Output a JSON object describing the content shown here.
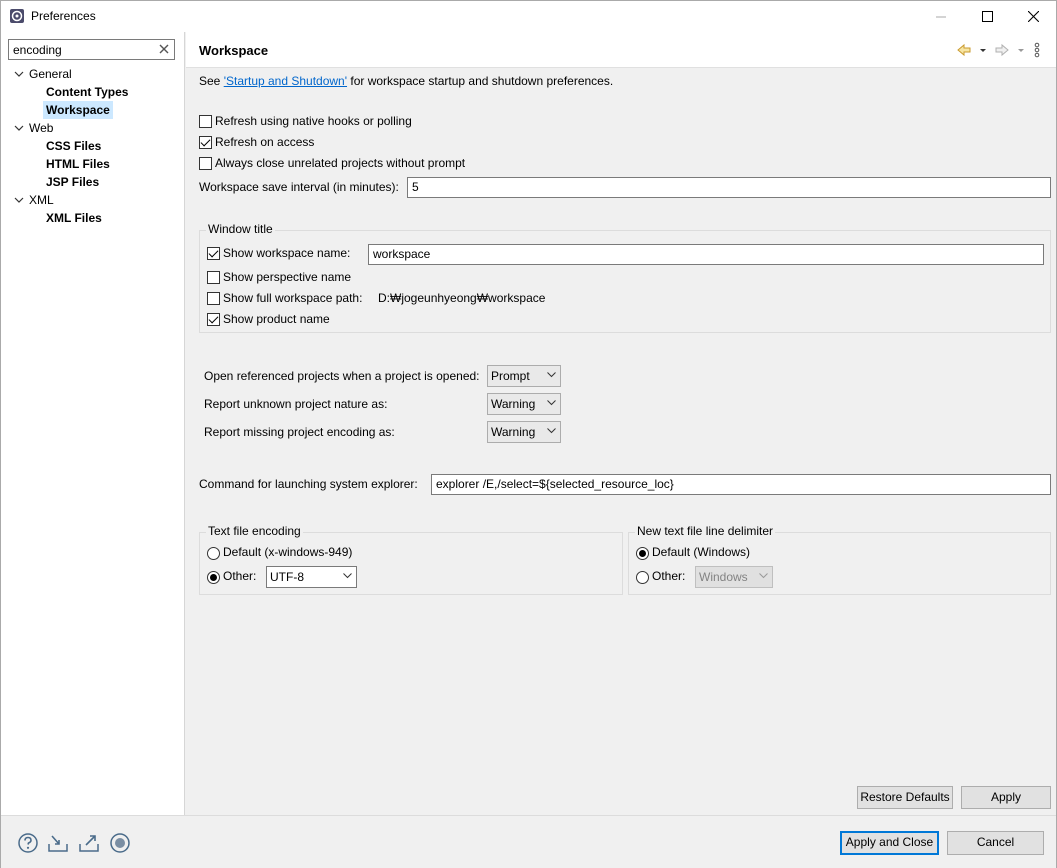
{
  "window": {
    "title": "Preferences"
  },
  "filter": {
    "value": "encoding"
  },
  "tree": {
    "items": [
      {
        "label": "General"
      },
      {
        "label": "Content Types"
      },
      {
        "label": "Workspace"
      },
      {
        "label": "Web"
      },
      {
        "label": "CSS Files"
      },
      {
        "label": "HTML Files"
      },
      {
        "label": "JSP Files"
      },
      {
        "label": "XML"
      },
      {
        "label": "XML Files"
      }
    ]
  },
  "page": {
    "title": "Workspace",
    "intro_prefix": "See ",
    "intro_link": "'Startup and Shutdown'",
    "intro_suffix": " for workspace startup and shutdown preferences.",
    "refresh_native": "Refresh using native hooks or polling",
    "refresh_access": "Refresh on access",
    "always_close": "Always close unrelated projects without prompt",
    "save_interval_label": "Workspace save interval (in minutes):",
    "save_interval_value": "5"
  },
  "window_title_group": {
    "label": "Window title",
    "show_workspace_name": "Show workspace name:",
    "workspace_name_value": "workspace",
    "show_perspective_name": "Show perspective name",
    "show_full_path": "Show full workspace path:",
    "full_path_value": "D:₩jogeunhyeong₩workspace",
    "show_product_name": "Show product name"
  },
  "project_options": {
    "open_referenced_label": "Open referenced projects when a project is opened:",
    "open_referenced_value": "Prompt",
    "unknown_nature_label": "Report unknown project nature as:",
    "unknown_nature_value": "Warning",
    "missing_encoding_label": "Report missing project encoding as:",
    "missing_encoding_value": "Warning"
  },
  "explorer": {
    "label": "Command for launching system explorer:",
    "value": "explorer /E,/select=${selected_resource_loc}"
  },
  "text_encoding": {
    "label": "Text file encoding",
    "default_label": "Default (x-windows-949)",
    "other_label": "Other:",
    "other_value": "UTF-8"
  },
  "line_delimiter": {
    "label": "New text file line delimiter",
    "default_label": "Default (Windows)",
    "other_label": "Other:",
    "other_value": "Windows"
  },
  "buttons": {
    "restore_defaults": "Restore Defaults",
    "apply": "Apply",
    "apply_and_close": "Apply and Close",
    "cancel": "Cancel"
  }
}
